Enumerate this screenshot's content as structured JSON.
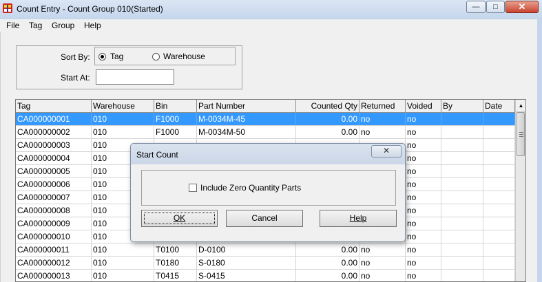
{
  "window": {
    "title": "Count Entry - Count Group 010(Started)",
    "minimize_glyph": "—",
    "maximize_glyph": "□",
    "close_glyph": "✕"
  },
  "menu": [
    "File",
    "Tag",
    "Group",
    "Help"
  ],
  "sort": {
    "label": "Sort By:",
    "options": [
      "Tag",
      "Warehouse"
    ],
    "selected": "Tag",
    "start_at_label": "Start At:",
    "start_at_value": ""
  },
  "grid": {
    "columns": [
      "Tag",
      "Warehouse",
      "Bin",
      "Part Number",
      "Counted Qty",
      "Returned",
      "Voided",
      "By",
      "Date"
    ],
    "rows": [
      {
        "tag": "CA000000001",
        "warehouse": "010",
        "bin": "F1000",
        "part": "M-0034M-45",
        "qty": "0.00",
        "returned": "no",
        "voided": "no",
        "by": "",
        "date": ""
      },
      {
        "tag": "CA000000002",
        "warehouse": "010",
        "bin": "F1000",
        "part": "M-0034M-50",
        "qty": "0.00",
        "returned": "no",
        "voided": "no",
        "by": "",
        "date": ""
      },
      {
        "tag": "CA000000003",
        "warehouse": "010",
        "bin": "",
        "part": "",
        "qty": "",
        "returned": "",
        "voided": "no",
        "by": "",
        "date": ""
      },
      {
        "tag": "CA000000004",
        "warehouse": "010",
        "bin": "",
        "part": "",
        "qty": "",
        "returned": "",
        "voided": "no",
        "by": "",
        "date": ""
      },
      {
        "tag": "CA000000005",
        "warehouse": "010",
        "bin": "",
        "part": "",
        "qty": "",
        "returned": "",
        "voided": "no",
        "by": "",
        "date": ""
      },
      {
        "tag": "CA000000006",
        "warehouse": "010",
        "bin": "",
        "part": "",
        "qty": "",
        "returned": "",
        "voided": "no",
        "by": "",
        "date": ""
      },
      {
        "tag": "CA000000007",
        "warehouse": "010",
        "bin": "",
        "part": "",
        "qty": "",
        "returned": "",
        "voided": "no",
        "by": "",
        "date": ""
      },
      {
        "tag": "CA000000008",
        "warehouse": "010",
        "bin": "",
        "part": "",
        "qty": "",
        "returned": "",
        "voided": "no",
        "by": "",
        "date": ""
      },
      {
        "tag": "CA000000009",
        "warehouse": "010",
        "bin": "",
        "part": "",
        "qty": "",
        "returned": "",
        "voided": "no",
        "by": "",
        "date": ""
      },
      {
        "tag": "CA000000010",
        "warehouse": "010",
        "bin": "",
        "part": "",
        "qty": "",
        "returned": "",
        "voided": "no",
        "by": "",
        "date": ""
      },
      {
        "tag": "CA000000011",
        "warehouse": "010",
        "bin": "T0100",
        "part": "D-0100",
        "qty": "0.00",
        "returned": "no",
        "voided": "no",
        "by": "",
        "date": ""
      },
      {
        "tag": "CA000000012",
        "warehouse": "010",
        "bin": "T0180",
        "part": "S-0180",
        "qty": "0.00",
        "returned": "no",
        "voided": "no",
        "by": "",
        "date": ""
      },
      {
        "tag": "CA000000013",
        "warehouse": "010",
        "bin": "T0415",
        "part": "S-0415",
        "qty": "0.00",
        "returned": "no",
        "voided": "no",
        "by": "",
        "date": ""
      }
    ],
    "selected_row": 0
  },
  "dialog": {
    "title": "Start Count",
    "close_glyph": "✕",
    "checkbox_label": "Include Zero Quantity Parts",
    "checkbox_checked": false,
    "ok_label": "OK",
    "cancel_label": "Cancel",
    "help_label": "Help"
  },
  "colors": {
    "selection": "#3399ff",
    "titlebar": "#c4d5ec"
  }
}
